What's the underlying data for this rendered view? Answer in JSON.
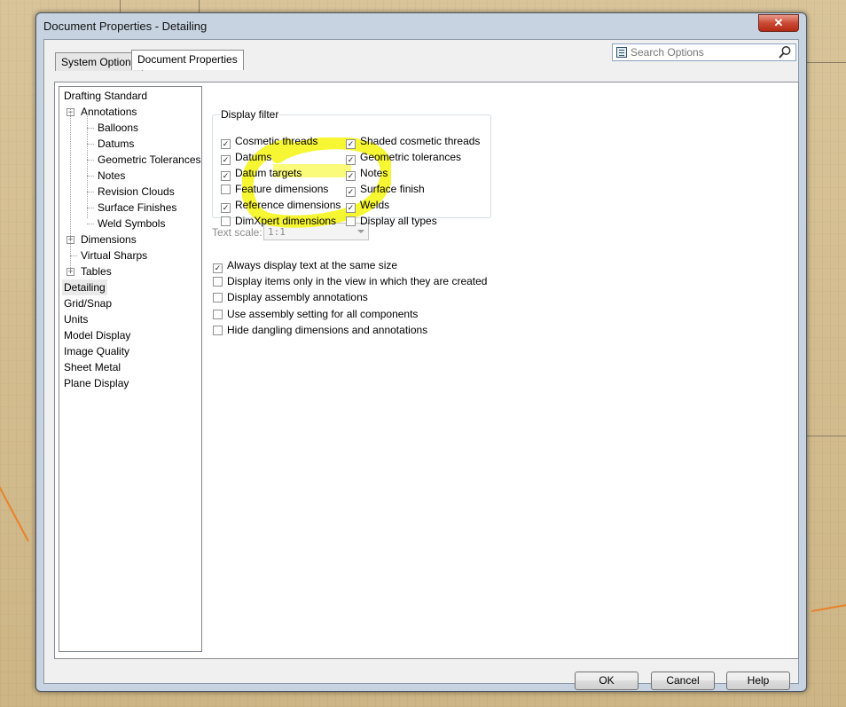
{
  "window": {
    "title": "Document Properties - Detailing",
    "close_label": "✕"
  },
  "tabs": [
    {
      "label": "System Options",
      "active": false
    },
    {
      "label": "Document Properties",
      "active": true
    }
  ],
  "search": {
    "placeholder": "Search Options"
  },
  "tree": {
    "items": [
      {
        "label": "Drafting Standard",
        "level": 0
      },
      {
        "label": "Annotations",
        "level": 1,
        "expander": "-"
      },
      {
        "label": "Balloons",
        "level": 2
      },
      {
        "label": "Datums",
        "level": 2
      },
      {
        "label": "Geometric Tolerances",
        "level": 2
      },
      {
        "label": "Notes",
        "level": 2
      },
      {
        "label": "Revision Clouds",
        "level": 2
      },
      {
        "label": "Surface Finishes",
        "level": 2
      },
      {
        "label": "Weld Symbols",
        "level": 2
      },
      {
        "label": "Dimensions",
        "level": 1,
        "expander": "+"
      },
      {
        "label": "Virtual Sharps",
        "level": 1
      },
      {
        "label": "Tables",
        "level": 1,
        "expander": "+"
      },
      {
        "label": "Detailing",
        "level": 0,
        "selected": true
      },
      {
        "label": "Grid/Snap",
        "level": 0
      },
      {
        "label": "Units",
        "level": 0
      },
      {
        "label": "Model Display",
        "level": 0
      },
      {
        "label": "Image Quality",
        "level": 0
      },
      {
        "label": "Sheet Metal",
        "level": 0
      },
      {
        "label": "Plane Display",
        "level": 0
      }
    ]
  },
  "display_filter": {
    "label": "Display filter",
    "left": [
      {
        "label": "Cosmetic threads",
        "checked": true
      },
      {
        "label": "Datums",
        "checked": true
      },
      {
        "label": "Datum targets",
        "checked": true
      },
      {
        "label": "Feature dimensions",
        "checked": false
      },
      {
        "label": "Reference dimensions",
        "checked": true
      },
      {
        "label": "DimXpert dimensions",
        "checked": false
      }
    ],
    "right": [
      {
        "label": "Shaded cosmetic threads",
        "checked": true
      },
      {
        "label": "Geometric tolerances",
        "checked": true
      },
      {
        "label": "Notes",
        "checked": true
      },
      {
        "label": "Surface finish",
        "checked": true
      },
      {
        "label": "Welds",
        "checked": true
      },
      {
        "label": "Display all types",
        "checked": false
      }
    ]
  },
  "text_scale": {
    "label": "Text scale:",
    "value": "1:1"
  },
  "options": [
    {
      "label": "Always display text at the same size",
      "checked": true
    },
    {
      "label": "Display items only in the view in which they are created",
      "checked": false
    },
    {
      "label": "Display assembly annotations",
      "checked": false
    },
    {
      "label": "Use assembly setting for all components",
      "checked": false
    },
    {
      "label": "Hide dangling dimensions and annotations",
      "checked": false
    }
  ],
  "buttons": {
    "ok": "OK",
    "cancel": "Cancel",
    "help": "Help"
  },
  "colors": {
    "highlight": "#f5f50f",
    "window_frame": "#c7d3e1",
    "background": "#d9c49a"
  }
}
